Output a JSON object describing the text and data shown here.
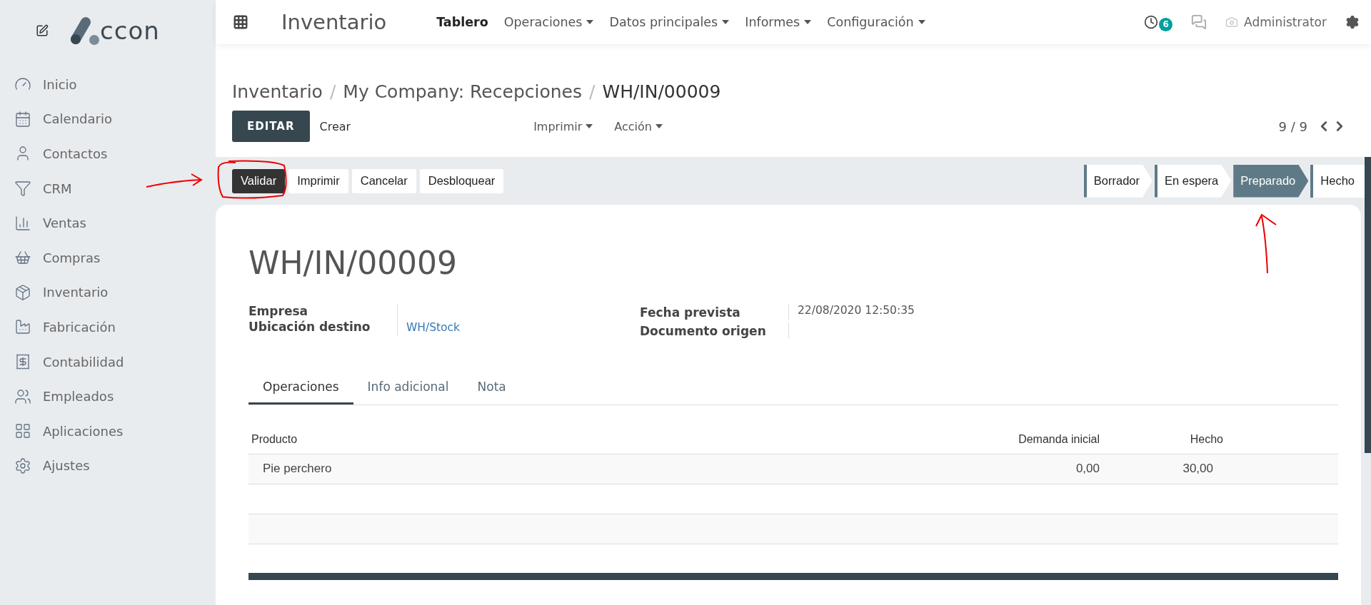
{
  "sidebar": {
    "logo": "ccon",
    "items": [
      "Inicio",
      "Calendario",
      "Contactos",
      "CRM",
      "Ventas",
      "Compras",
      "Inventario",
      "Fabricación",
      "Contabilidad",
      "Empleados",
      "Aplicaciones",
      "Ajustes"
    ]
  },
  "topbar": {
    "app_title": "Inventario",
    "menu": [
      {
        "label": "Tablero",
        "dropdown": false
      },
      {
        "label": "Operaciones",
        "dropdown": true
      },
      {
        "label": "Datos principales",
        "dropdown": true
      },
      {
        "label": "Informes",
        "dropdown": true
      },
      {
        "label": "Configuración",
        "dropdown": true
      }
    ],
    "activity_count": "6",
    "user": "Administrator"
  },
  "breadcrumb": {
    "items": [
      "Inventario",
      "My Company: Recepciones",
      "WH/IN/00009"
    ],
    "separator": "/"
  },
  "control": {
    "primary": "EDITAR",
    "secondary": "Crear",
    "menus": [
      "Imprimir",
      "Acción"
    ],
    "pager": "9 / 9"
  },
  "statusbar": {
    "buttons": [
      {
        "label": "Validar",
        "primary": true
      },
      {
        "label": "Imprimir",
        "primary": false
      },
      {
        "label": "Cancelar",
        "primary": false
      },
      {
        "label": "Desbloquear",
        "primary": false
      }
    ],
    "stages": [
      {
        "label": "Borrador",
        "selected": false
      },
      {
        "label": "En espera",
        "selected": false
      },
      {
        "label": "Preparado",
        "selected": true
      },
      {
        "label": "Hecho",
        "selected": false
      }
    ]
  },
  "sheet": {
    "title": "WH/IN/00009",
    "left_fields": [
      {
        "label": "Empresa"
      },
      {
        "label": "Ubicación destino",
        "value": "WH/Stock"
      }
    ],
    "right_fields": [
      {
        "label": "Fecha prevista",
        "value": "22/08/2020 12:50:35"
      },
      {
        "label": "Documento origen"
      }
    ],
    "tabs": [
      {
        "label": "Operaciones",
        "selected": true
      },
      {
        "label": "Info adicional",
        "selected": false
      },
      {
        "label": "Nota",
        "selected": false
      }
    ],
    "table": {
      "columns": [
        "Producto",
        "Demanda inicial",
        "Hecho"
      ],
      "rows": [
        [
          "Pie perchero",
          "0,00",
          "30,00"
        ]
      ]
    }
  }
}
